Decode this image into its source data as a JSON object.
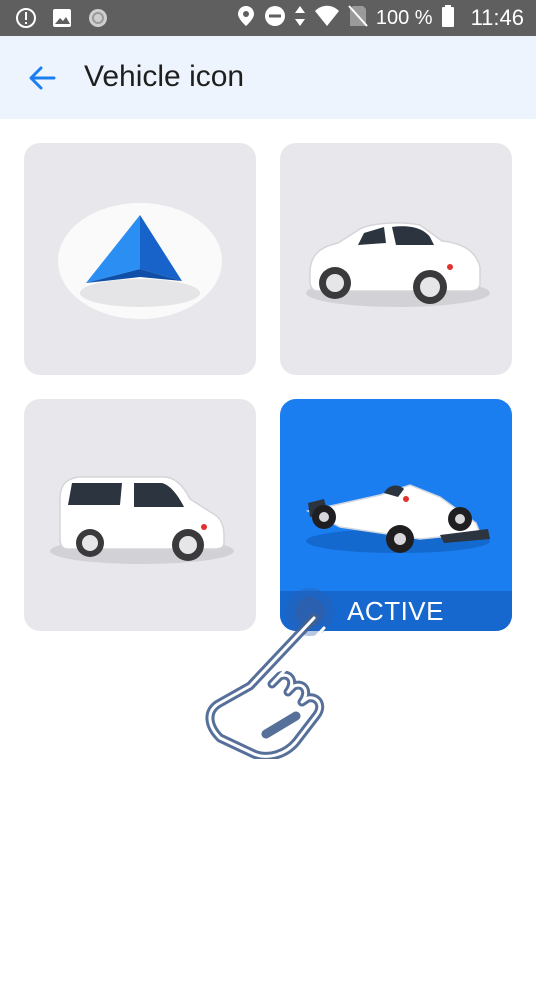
{
  "status_bar": {
    "battery_percent": "100 %",
    "time": "11:46",
    "icons": [
      "alert-icon",
      "image-icon",
      "circle-icon",
      "location-icon",
      "do-not-disturb-icon",
      "data-arrows-icon",
      "wifi-icon",
      "no-sim-icon",
      "battery-icon"
    ]
  },
  "app_bar": {
    "title": "Vehicle icon",
    "back_icon": "arrow-back-icon"
  },
  "vehicles": [
    {
      "icon": "navigation-arrow-icon",
      "active": false
    },
    {
      "icon": "sports-car-icon",
      "active": false
    },
    {
      "icon": "compact-car-icon",
      "active": false
    },
    {
      "icon": "race-car-icon",
      "active": true,
      "badge": "ACTIVE"
    }
  ],
  "overlay": {
    "icon": "tap-hand-icon"
  },
  "colors": {
    "accent": "#1a7df0",
    "tile_bg": "#e8e8ec",
    "app_bar_bg": "#eef4fd",
    "status_bar_bg": "#5f5f5f"
  }
}
